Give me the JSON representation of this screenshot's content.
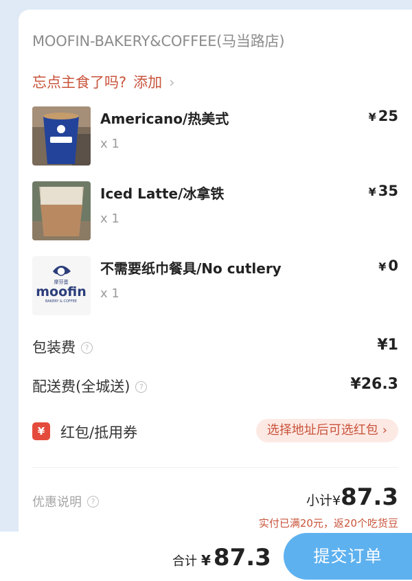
{
  "shop": {
    "name": "MOOFIN-BAKERY&COFFEE(马当路店)"
  },
  "upsell": {
    "prompt": "忘点主食了吗?",
    "action": "添加",
    "chevron": "›"
  },
  "items": [
    {
      "name": "Americano/热美式",
      "qty": "x 1",
      "currency": "¥",
      "price": "25",
      "thumb": "americano-cup-photo"
    },
    {
      "name": "Iced Latte/冰拿铁",
      "qty": "x 1",
      "currency": "¥",
      "price": "35",
      "thumb": "iced-latte-photo"
    },
    {
      "name": "不需要纸巾餐具/No cutlery",
      "qty": "x 1",
      "currency": "¥",
      "price": "0",
      "thumb": "moofin-logo",
      "logo": {
        "small": "摩芬蛋",
        "brand": "moofin",
        "tagline": "BAKERY & COFFEE"
      }
    }
  ],
  "fees": {
    "packaging": {
      "label": "包装费",
      "value": "¥1"
    },
    "delivery": {
      "label": "配送费(全城送)",
      "value": "¥26.3"
    }
  },
  "coupon": {
    "icon": "¥",
    "label": "红包/抵用券",
    "pill": "选择地址后可选红包",
    "chevron": "›"
  },
  "summary": {
    "promo_label": "优惠说明",
    "subtotal_label": "小计¥",
    "subtotal_value": "87.3",
    "rebate_note": "实付已满20元，返20个吃货豆"
  },
  "footer": {
    "total_label": "合计",
    "currency": "¥",
    "total_value": "87.3",
    "submit_label": "提交订单"
  },
  "colors": {
    "accent_red": "#c8533a",
    "submit_blue": "#5eb1ef",
    "coupon_red": "#e54b3c"
  }
}
